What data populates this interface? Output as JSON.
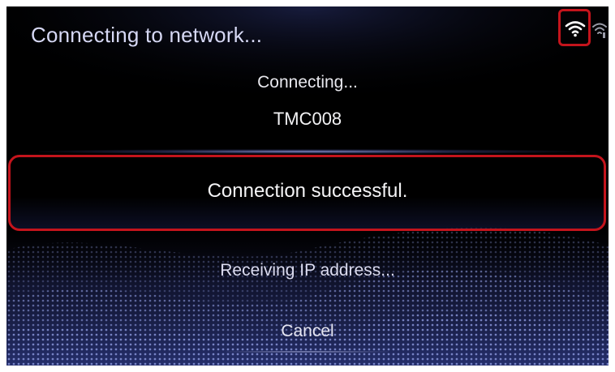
{
  "header": {
    "title": "Connecting to network...",
    "icons": [
      "wifi-connected-icon",
      "wifi-secondary-icon"
    ]
  },
  "status": {
    "connecting_label": "Connecting...",
    "network_name": "TMC008",
    "result_message": "Connection successful.",
    "progress_message": "Receiving IP address..."
  },
  "actions": {
    "cancel_label": "Cancel"
  },
  "colors": {
    "background": "#000000",
    "highlight": "#c4141c",
    "wave_accent": "#3c4aa0",
    "title_text": "#d6d8f4"
  }
}
